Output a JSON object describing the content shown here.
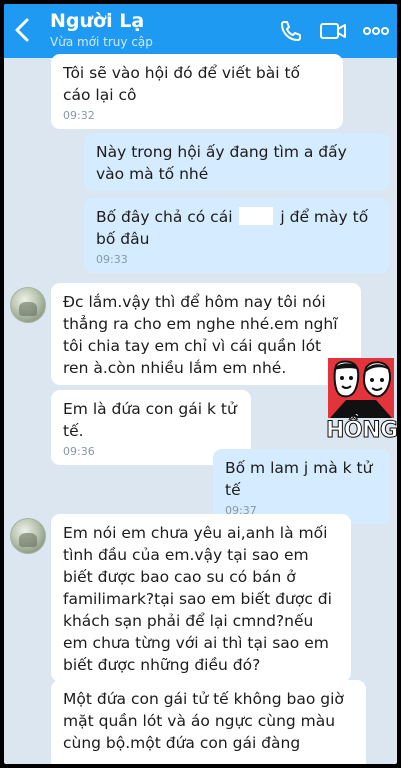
{
  "header": {
    "contact_name": "Người Lạ",
    "status": "Vừa mới truy cập",
    "back_icon": "chevron-left-icon",
    "call_icon": "phone-icon",
    "video_icon": "video-camera-icon",
    "more_icon": "more-dots-icon"
  },
  "messages": [
    {
      "text": "Tôi sẽ vào hội đó để viết bài tố cáo lại cô",
      "time": "09:32",
      "from": "them"
    },
    {
      "text": "Này trong hội ấy đang tìm a đấy vào mà tố nhé",
      "time": "",
      "from": "me"
    },
    {
      "text_before": "Bố đây chả có cái",
      "text_after": "j để mày tố bố đâu",
      "time": "09:33",
      "from": "me"
    },
    {
      "text": "Đc lắm.vậy thì để hôm nay tôi nói thẳng ra cho em nghe nhé.em nghĩ tôi chia tay em chỉ vì cái quần lót ren à.còn nhiều lắm em nhé.",
      "time": "",
      "from": "them"
    },
    {
      "text": "Em là đứa con gái k tử tế.",
      "time": "09:36",
      "from": "them"
    },
    {
      "text": "Bố m lam j mà k tử tế",
      "time": "09:37",
      "from": "me"
    },
    {
      "text": "Em nói em chưa yêu ai,anh là mối tình đầu của em.vậy tại sao em biết được bao cao su có bán ở familimark?tại sao em biết được đi khách sạn phải để lại cmnd?nếu em chưa từng với ai thì tại sao em biết được những điều đó?",
      "time": "",
      "from": "them"
    },
    {
      "text": "Một đứa con gái tử tế không bao giờ mặt quần lót và áo ngực cùng màu cùng bộ.một đứa con gái đàng",
      "time": "",
      "from": "them"
    }
  ],
  "watermark": {
    "text": "HỒNG"
  },
  "colors": {
    "header": "#1f9af2",
    "background": "#dbe6f1",
    "incoming": "#ffffff",
    "outgoing": "#d5ebff"
  }
}
